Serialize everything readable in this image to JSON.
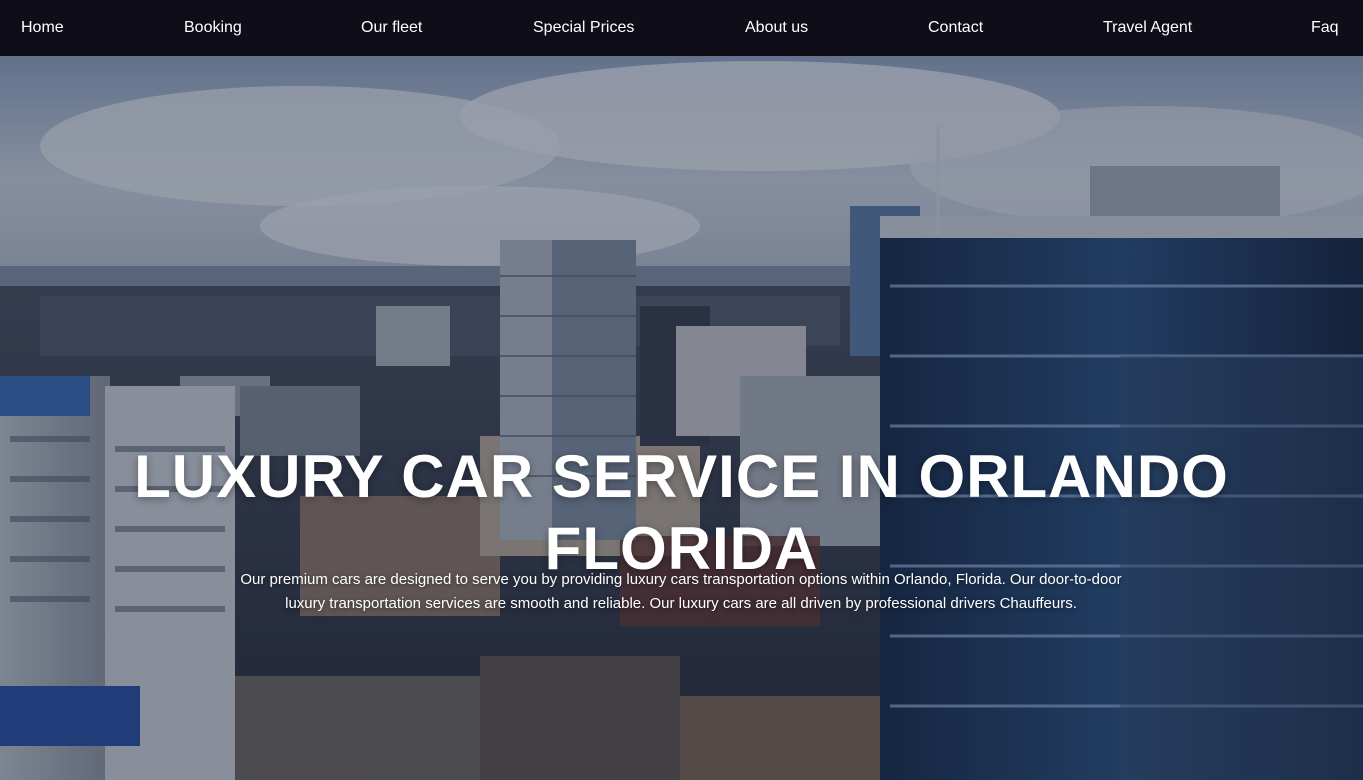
{
  "nav": {
    "items": [
      {
        "label": "Home"
      },
      {
        "label": "Booking"
      },
      {
        "label": "Our fleet"
      },
      {
        "label": "Special Prices"
      },
      {
        "label": "About us"
      },
      {
        "label": "Contact"
      },
      {
        "label": "Travel Agent"
      },
      {
        "label": "Faq"
      }
    ]
  },
  "hero": {
    "background": "aerial-city-skyline-image",
    "title": "LUXURY CAR SERVICE IN ORLANDO FLORIDA",
    "description": "Our premium cars are designed to serve you by providing luxury cars transportation options within Orlando, Florida. Our door-to-door luxury transportation services are smooth and reliable. Our luxury cars are all driven by professional drivers Chauffeurs."
  },
  "colors": {
    "nav_background": "#0e0d18",
    "text": "#ffffff"
  }
}
